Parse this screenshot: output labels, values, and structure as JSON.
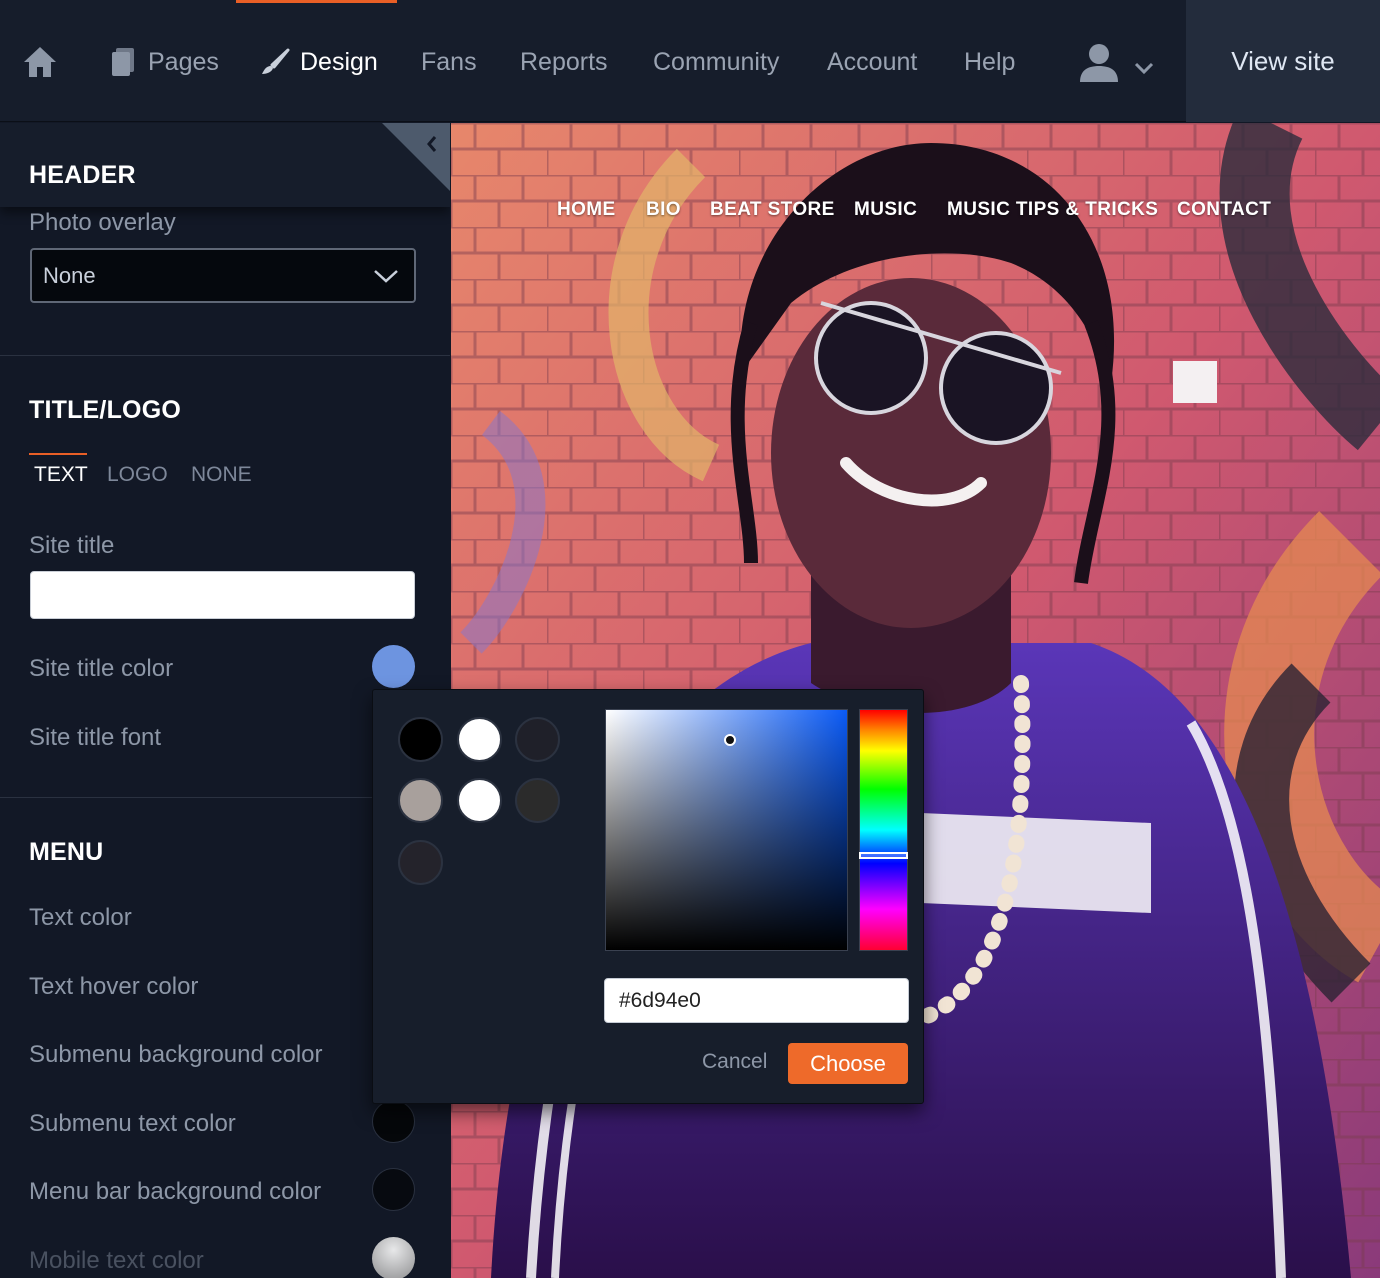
{
  "nav": {
    "items": [
      {
        "label": "Pages",
        "icon": "pages-icon"
      },
      {
        "label": "Design",
        "icon": "brush-icon"
      },
      {
        "label": "Fans"
      },
      {
        "label": "Reports"
      },
      {
        "label": "Community"
      },
      {
        "label": "Account"
      },
      {
        "label": "Help"
      }
    ],
    "home_icon": "home-icon",
    "user_icon": "user-icon",
    "view_site": "View site",
    "active": "Design"
  },
  "sidebar": {
    "header": {
      "title": "HEADER",
      "photo_overlay_label": "Photo overlay",
      "photo_overlay_value": "None"
    },
    "title_logo": {
      "title": "TITLE/LOGO",
      "tabs": [
        "TEXT",
        "LOGO",
        "NONE"
      ],
      "active_tab": "TEXT",
      "site_title_label": "Site title",
      "site_title_value": "",
      "site_title_color_label": "Site title color",
      "site_title_color": "#6d94e0",
      "site_title_font_label": "Site title font"
    },
    "menu": {
      "title": "MENU",
      "text_color": "Text color",
      "text_hover_color": "Text hover color",
      "submenu_bg_color": "Submenu background color",
      "submenu_text_color": "Submenu text color",
      "menu_bar_bg_color": "Menu bar background color",
      "mobile_text_color": "Mobile text color"
    }
  },
  "preview": {
    "menu": [
      "HOME",
      "BIO",
      "BEAT STORE",
      "MUSIC",
      "MUSIC TIPS & TRICKS",
      "CONTACT"
    ]
  },
  "color_picker": {
    "presets": [
      "#000000",
      "#ffffff",
      "#1f2029",
      "#a8a09c",
      "#ffffff",
      "#2b2b2b",
      "#24232b"
    ],
    "hex_value": "#6d94e0",
    "cancel_label": "Cancel",
    "choose_label": "Choose",
    "accent": "#ee6a2a"
  }
}
